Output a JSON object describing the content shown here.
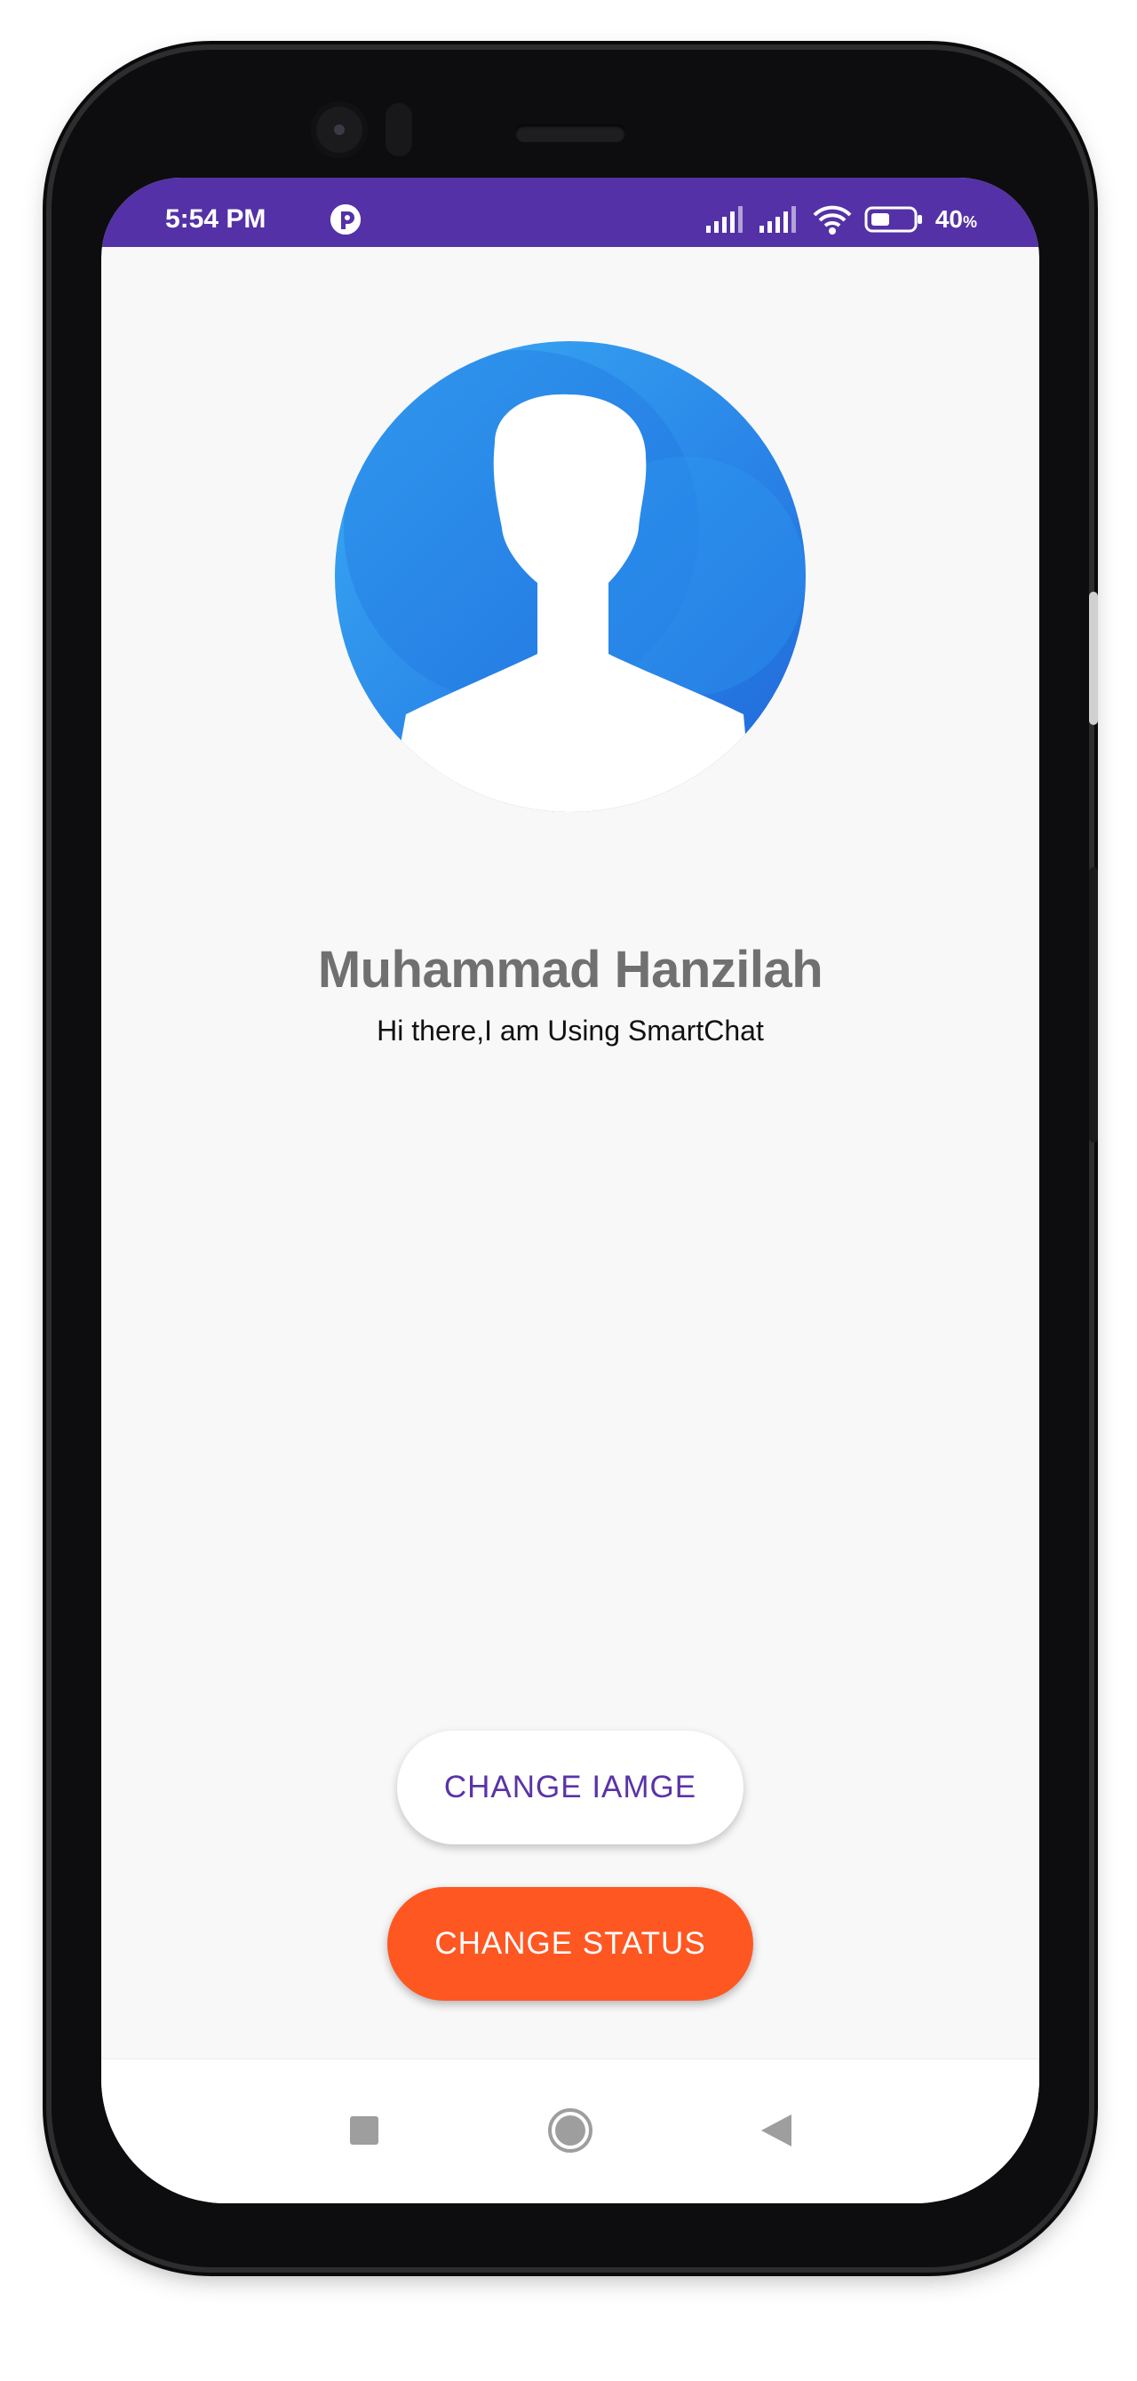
{
  "status_bar": {
    "time": "5:54 PM",
    "battery_percent": "40",
    "battery_unit": "%",
    "icons": [
      "app-notification-icon",
      "signal-icon",
      "signal-icon",
      "wifi-icon",
      "battery-icon"
    ],
    "background_color": "#5431a6"
  },
  "profile": {
    "avatar_icon": "default-user-avatar",
    "name": "Muhammad Hanzilah",
    "status_text": "Hi there,I am Using SmartChat"
  },
  "actions": {
    "change_image_label": "CHANGE IAMGE",
    "change_status_label": "CHANGE STATUS",
    "change_status_color": "#ff5722",
    "change_image_text_color": "#5a33a8"
  },
  "navigation": {
    "icons": [
      "recents-square-icon",
      "home-circle-icon",
      "back-triangle-icon"
    ]
  }
}
